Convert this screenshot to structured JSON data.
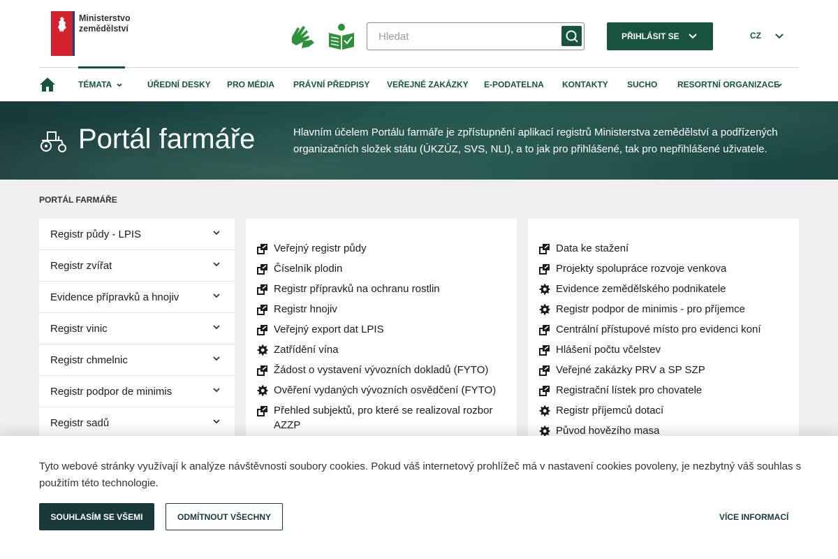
{
  "header": {
    "logo_line1": "Ministerstvo",
    "logo_line2": "zemědělství",
    "search_placeholder": "Hledat",
    "login_label": "PŘIHLÁSIT SE",
    "lang_label": "CZ"
  },
  "nav": {
    "items": [
      {
        "label": "TÉMATA"
      },
      {
        "label": "ÚŘEDNÍ DESKY"
      },
      {
        "label": "PRO MÉDIA"
      },
      {
        "label": "PRÁVNÍ PŘEDPISY"
      },
      {
        "label": "VEŘEJNÉ ZAKÁZKY"
      },
      {
        "label": "E-PODATELNA"
      },
      {
        "label": "KONTAKTY"
      },
      {
        "label": "SUCHO"
      },
      {
        "label": "RESORTNÍ ORGANIZACE"
      }
    ]
  },
  "hero": {
    "title": "Portál farmáře",
    "description": "Hlavním účelem Portálu farmáře je zpřístupnění aplikací registrů Ministerstva zemědělství a podřízených organizačních složek státu (ÚKZÚZ, SVS, NLI), a to jak pro přihlášené, tak pro nepřihlášené uživatele."
  },
  "sidebar": {
    "title": "PORTÁL FARMÁŘE",
    "items": [
      {
        "label": "Registr půdy - LPIS"
      },
      {
        "label": "Registr zvířat"
      },
      {
        "label": "Evidence přípravků a hnojiv"
      },
      {
        "label": "Registr vinic"
      },
      {
        "label": "Registr chmelnic"
      },
      {
        "label": "Registr podpor de minimis"
      },
      {
        "label": "Registr sadů"
      }
    ]
  },
  "panel_left": {
    "links": [
      {
        "label": "Veřejný registr půdy",
        "icon": "external-link-icon"
      },
      {
        "label": "Číselník plodin",
        "icon": "external-link-icon"
      },
      {
        "label": "Registr přípravků na ochranu rostlin",
        "icon": "external-link-icon"
      },
      {
        "label": "Registr hnojiv",
        "icon": "external-link-icon"
      },
      {
        "label": "Veřejný export dat LPIS",
        "icon": "external-link-icon"
      },
      {
        "label": "Zatřídění vína",
        "icon": "gear-icon"
      },
      {
        "label": "Žádost o vystavení vývozních dokladů (FYTO)",
        "icon": "external-link-icon"
      },
      {
        "label": "Ověření vydaných vývozních osvědčení (FYTO)",
        "icon": "gear-icon"
      },
      {
        "label": "Přehled subjektů, pro které se realizoval rozbor AZZP",
        "icon": "external-link-icon"
      }
    ]
  },
  "panel_right": {
    "links": [
      {
        "label": "Data ke stažení",
        "icon": "external-link-icon"
      },
      {
        "label": "Projekty spolupráce rozvoje venkova",
        "icon": "external-link-icon"
      },
      {
        "label": "Evidence zemědělského podnikatele",
        "icon": "gear-icon"
      },
      {
        "label": "Registr podpor de minimis - pro příjemce",
        "icon": "gear-icon"
      },
      {
        "label": "Centrální přístupové místo pro evidenci koní",
        "icon": "external-link-icon"
      },
      {
        "label": "Hlášení počtu včelstev",
        "icon": "external-link-icon"
      },
      {
        "label": "Veřejné zakázky PRV a SP SZP",
        "icon": "external-link-icon"
      },
      {
        "label": "Registrační lístek pro chovatele",
        "icon": "external-link-icon"
      },
      {
        "label": "Registr příjemců dotací",
        "icon": "gear-icon"
      },
      {
        "label": "Původ hovězího masa",
        "icon": "gear-icon"
      }
    ]
  },
  "cookies": {
    "text": "Tyto webové stránky využívají k analýze návštěvnosti soubory cookies. Pokud váš internetový prohlížeč má v nastavení cookies povoleny, je nezbytný váš souhlas s použitím této technologie.",
    "accept_label": "SOUHLASÍM SE VŠEMI",
    "reject_label": "ODMÍTNOUT VŠECHNY",
    "more_label": "VÍCE INFORMACÍ"
  },
  "colors": {
    "primary": "#17533e",
    "dark": "#17393a",
    "brand_red": "#d2222d",
    "brand_blue": "#11457e"
  }
}
